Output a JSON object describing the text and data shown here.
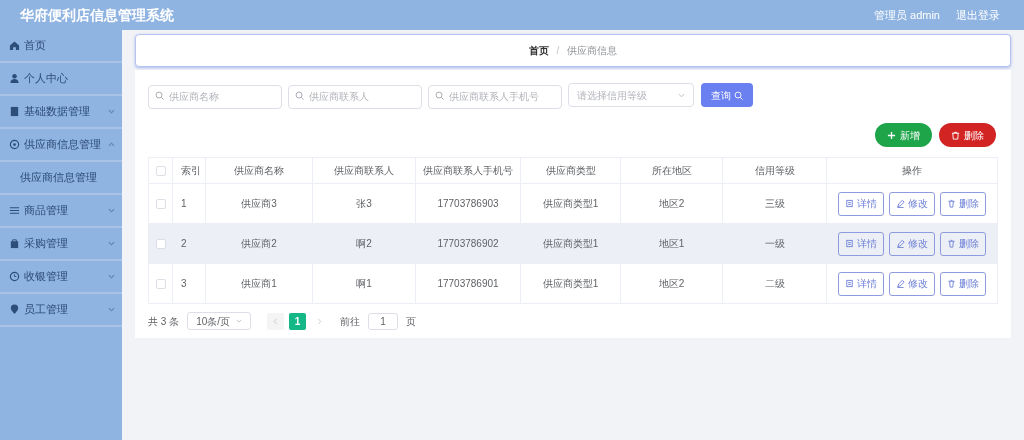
{
  "header": {
    "title": "华府便利店信息管理系统",
    "user": "管理员 admin",
    "logout": "退出登录"
  },
  "sidebar": {
    "items": [
      {
        "label": "首页"
      },
      {
        "label": "个人中心"
      },
      {
        "label": "基础数据管理",
        "expandable": true,
        "expanded": false
      },
      {
        "label": "供应商信息管理",
        "expandable": true,
        "expanded": true,
        "children": [
          {
            "label": "供应商信息管理"
          }
        ]
      },
      {
        "label": "商品管理",
        "expandable": true,
        "expanded": false
      },
      {
        "label": "采购管理",
        "expandable": true,
        "expanded": false
      },
      {
        "label": "收银管理",
        "expandable": true,
        "expanded": false
      },
      {
        "label": "员工管理",
        "expandable": true,
        "expanded": false
      }
    ]
  },
  "breadcrumb": {
    "items": [
      "首页",
      "供应商信息"
    ],
    "separator": "/"
  },
  "filters": [
    {
      "kind": "input",
      "placeholder": "供应商名称"
    },
    {
      "kind": "input",
      "placeholder": "供应商联系人"
    },
    {
      "kind": "input",
      "placeholder": "供应商联系人手机号"
    },
    {
      "kind": "select",
      "placeholder": "请选择信用等级"
    }
  ],
  "search_button": "查询",
  "add_button": "新增",
  "delete_button": "删除",
  "table": {
    "select_all_checked": false,
    "columns": [
      "索引",
      "供应商名称",
      "供应商联系人",
      "供应商联系人手机号",
      "供应商类型",
      "所在地区",
      "信用等级",
      "操作"
    ],
    "rows": [
      {
        "checked": false,
        "highlighted": false,
        "cells": [
          "1",
          "供应商3",
          "张3",
          "17703786903",
          "供应商类型1",
          "地区2",
          "三级"
        ],
        "actions": [
          "详情",
          "修改",
          "删除"
        ]
      },
      {
        "checked": false,
        "highlighted": true,
        "cells": [
          "2",
          "供应商2",
          "啊2",
          "17703786902",
          "供应商类型1",
          "地区1",
          "一级"
        ],
        "actions": [
          "详情",
          "修改",
          "删除"
        ]
      },
      {
        "checked": false,
        "highlighted": false,
        "cells": [
          "3",
          "供应商1",
          "啊1",
          "17703786901",
          "供应商类型1",
          "地区2",
          "二级"
        ],
        "actions": [
          "详情",
          "修改",
          "删除"
        ]
      }
    ]
  },
  "pagination": {
    "total": "共 3 条",
    "page_size": "10条/页",
    "pages": [
      {
        "label": "1",
        "selected": true
      }
    ],
    "goto_label": "前往",
    "goto_value": "1",
    "goto_suffix": "页"
  }
}
